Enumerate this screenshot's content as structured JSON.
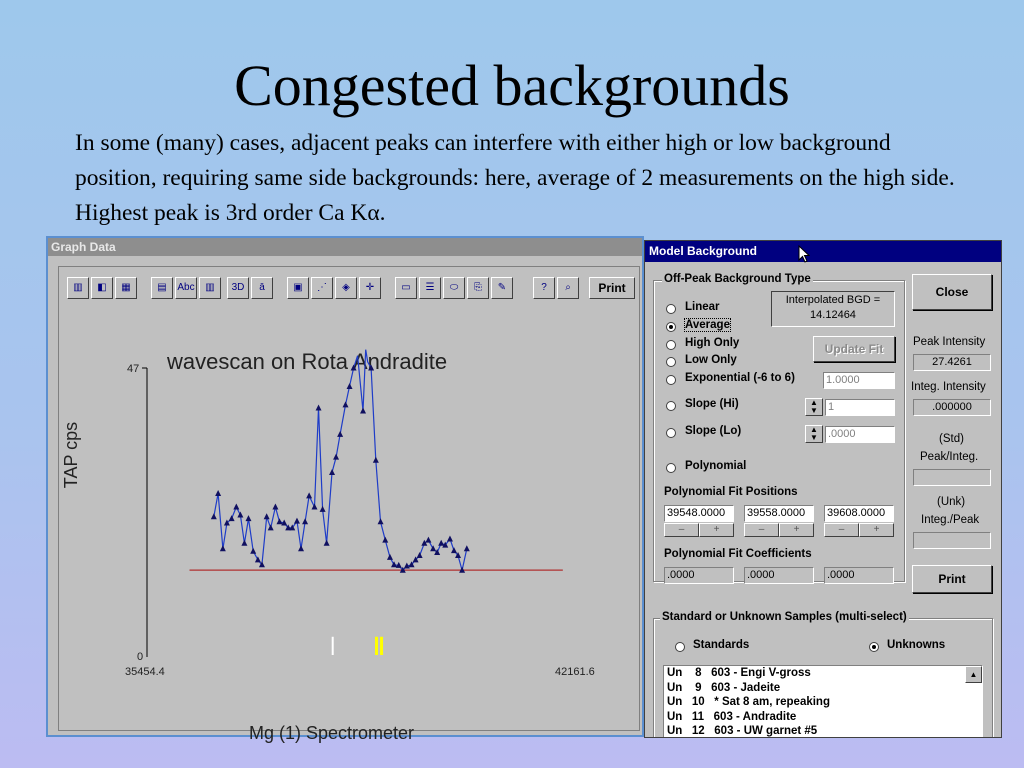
{
  "slide": {
    "title": "Congested backgrounds",
    "body": "In some (many) cases, adjacent peaks can interfere with either high or low background position, requiring same side backgrounds: here, average of 2 measurements on the high side. Highest peak is 3rd order Ca Kα."
  },
  "graph_window": {
    "title": "Graph Data",
    "print_label": "Print",
    "chart_title": "wavescan on Rota Andradite",
    "ylabel": "TAP cps",
    "xlabel": "Mg (1) Spectrometer",
    "y_max_label": "47",
    "y_min_label": "0",
    "x_min_label": "35454.4",
    "x_max_label": "42161.6",
    "toolbar_icons": [
      "bar-chart-icon",
      "area-chart-icon",
      "grid-chart-icon",
      "table-icon",
      "abc-icon",
      "data-grid-icon",
      "3d-icon",
      "font-icon",
      "color-icon",
      "marker-icon",
      "palette-icon",
      "move-icon",
      "legend-icon",
      "list-icon",
      "label-icon",
      "copy-icon",
      "pen-icon",
      "help-icon",
      "zoom-icon"
    ]
  },
  "chart_data": {
    "type": "line",
    "title": "wavescan on Rota Andradite",
    "xlabel": "Mg (1) Spectrometer",
    "ylabel": "TAP cps",
    "xlim": [
      35454.4,
      42161.6
    ],
    "ylim": [
      0,
      47
    ],
    "series": [
      {
        "name": "",
        "color": "#1e3cc8",
        "points": [
          [
            36446,
            22.8
          ],
          [
            36510,
            26.6
          ],
          [
            36580,
            17.6
          ],
          [
            36640,
            21.8
          ],
          [
            36710,
            22.5
          ],
          [
            36780,
            24.4
          ],
          [
            36840,
            23.1
          ],
          [
            36900,
            18.5
          ],
          [
            36960,
            22.5
          ],
          [
            37030,
            17.2
          ],
          [
            37100,
            15.8
          ],
          [
            37160,
            15
          ],
          [
            37230,
            22.8
          ],
          [
            37290,
            21
          ],
          [
            37360,
            24.4
          ],
          [
            37420,
            22
          ],
          [
            37490,
            21.8
          ],
          [
            37550,
            21
          ],
          [
            37610,
            21
          ],
          [
            37680,
            22.1
          ],
          [
            37740,
            17.6
          ],
          [
            37800,
            22
          ],
          [
            37860,
            26.2
          ],
          [
            37940,
            24.4
          ],
          [
            38000,
            40.5
          ],
          [
            38060,
            24
          ],
          [
            38120,
            18.5
          ],
          [
            38200,
            30
          ],
          [
            38260,
            32.5
          ],
          [
            38320,
            36.2
          ],
          [
            38400,
            41
          ],
          [
            38460,
            44
          ],
          [
            38520,
            47
          ],
          [
            38580,
            49
          ],
          [
            38660,
            40
          ],
          [
            38700,
            50
          ],
          [
            38730,
            48
          ],
          [
            38780,
            47
          ],
          [
            38850,
            32
          ],
          [
            38920,
            22
          ],
          [
            38990,
            19
          ],
          [
            39060,
            16.2
          ],
          [
            39120,
            15
          ],
          [
            39190,
            14.9
          ],
          [
            39250,
            14.1
          ],
          [
            39310,
            14.8
          ],
          [
            39380,
            15
          ],
          [
            39440,
            15.8
          ],
          [
            39500,
            16.5
          ],
          [
            39570,
            18.5
          ],
          [
            39630,
            19
          ],
          [
            39700,
            17.6
          ],
          [
            39760,
            17
          ],
          [
            39820,
            18.5
          ],
          [
            39880,
            18.2
          ],
          [
            39950,
            19.2
          ],
          [
            40010,
            17.3
          ],
          [
            40070,
            16.5
          ],
          [
            40130,
            14.1
          ],
          [
            40200,
            17.6
          ]
        ]
      }
    ],
    "baseline": {
      "value": 14.12464,
      "color": "#b03030",
      "x_from": 36085,
      "x_to": 41625
    },
    "markers": [
      {
        "x": 38210,
        "color": "#ffffff"
      },
      {
        "x": 38860,
        "color": "#ffff00"
      },
      {
        "x": 38935,
        "color": "#ffff00"
      }
    ]
  },
  "dialog": {
    "title": "Model Background",
    "offpeak_group": "Off-Peak Background Type",
    "interp_label": "Interpolated BGD =",
    "interp_value": "14.12464",
    "options": [
      "Linear",
      "Average",
      "High Only",
      "Low Only",
      "Exponential (-6 to 6)",
      "Slope (Hi)",
      "Slope (Lo)",
      "Polynomial"
    ],
    "selected_option": "Average",
    "update_fit": "Update Fit",
    "exp_value": "1.0000",
    "slope_hi_value": "1",
    "slope_lo_value": ".0000",
    "poly_positions_label": "Polynomial Fit Positions",
    "poly_positions": [
      "39548.0000",
      "39558.0000",
      "39608.0000"
    ],
    "minus": "–",
    "plus": "+",
    "poly_coeffs_label": "Polynomial Fit Coefficients",
    "poly_coeffs": [
      ".0000",
      ".0000",
      ".0000"
    ],
    "close": "Close",
    "peak_intensity_label": "Peak  Intensity",
    "peak_intensity": "27.4261",
    "integ_intensity_label": "Integ.  Intensity",
    "integ_intensity": ".000000",
    "std_label": "(Std)",
    "peak_integ_label": "Peak/Integ.",
    "unk_label": "(Unk)",
    "integ_peak_label": "Integ./Peak",
    "print": "Print",
    "samples_group": "Standard or Unknown Samples (multi-select)",
    "standards": "Standards",
    "unknowns": "Unknowns",
    "samples": [
      "Un    8   603 - Engi V-gross",
      "Un    9   603 - Jadeite",
      "Un   10   * Sat 8 am, repeaking",
      "Un   11   603 - Andradite",
      "Un   12   603 - UW garnet #5"
    ]
  }
}
